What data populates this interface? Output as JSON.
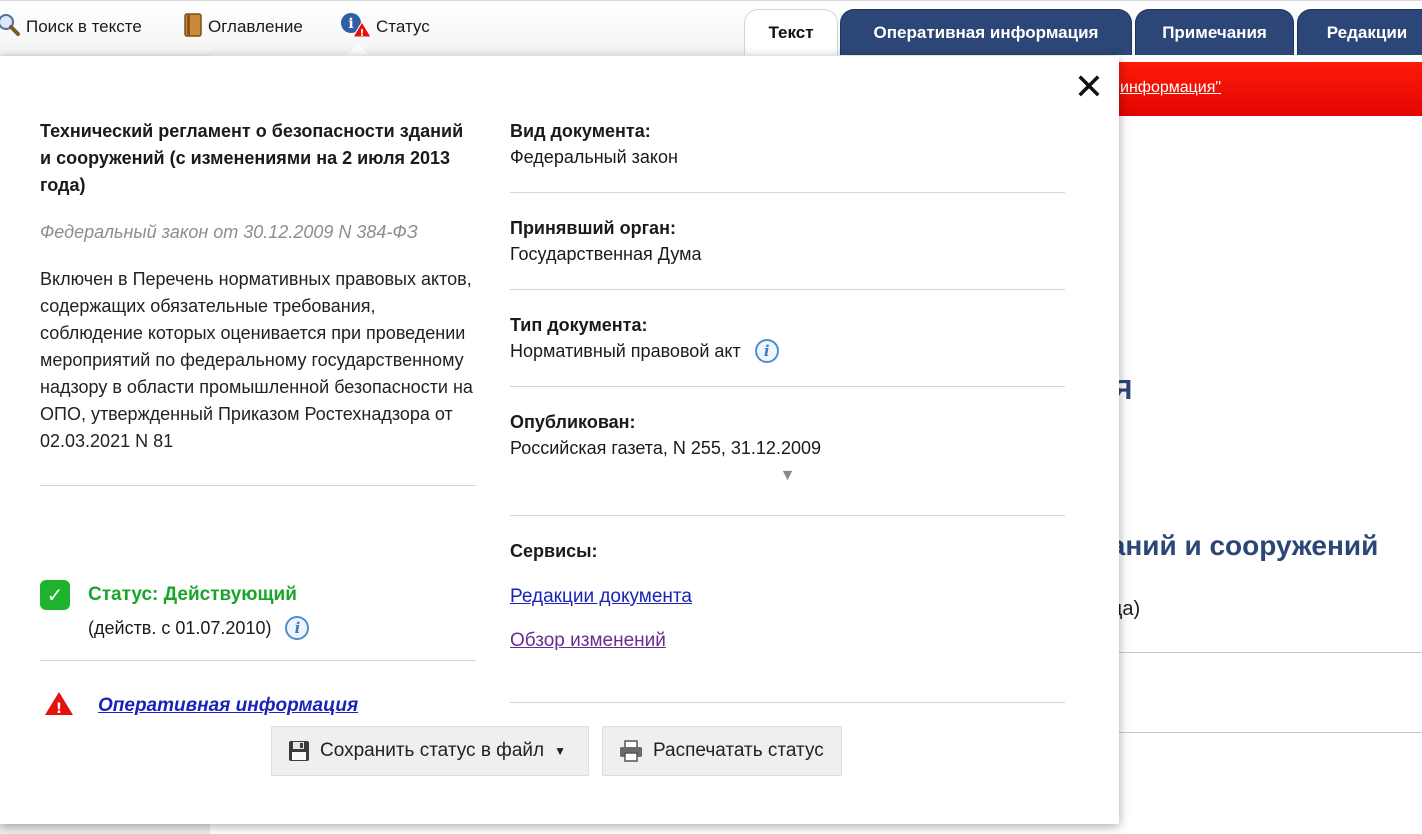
{
  "toolbar": {
    "search_label": "Поиск в тексте",
    "toc_label": "Оглавление",
    "status_label": "Статус"
  },
  "tabs": [
    {
      "label": "Текст",
      "active": true
    },
    {
      "label": "Оперативная информация",
      "active": false
    },
    {
      "label": "Примечания",
      "active": false
    },
    {
      "label": "Редакции",
      "active": false
    }
  ],
  "background_doc": {
    "banner_link": "информация\"",
    "heading_fragment_1": "ИЯ",
    "heading_fragment_2": "Я",
    "heading_fragment_3": "даний и сооружений",
    "text_fragment": "ода)"
  },
  "popup": {
    "close_symbol": "✕",
    "title": "Технический регламент о безопасности зданий и сооружений (с изменениями на 2 июля 2013 года)",
    "subtitle": "Федеральный закон от 30.12.2009 N 384-ФЗ",
    "description": "Включен в Перечень нормативных правовых актов, содержащих обязательные требования, соблюдение которых оценивается при проведении мероприятий по федеральному государственному надзору в области промышленной безопасности на ОПО, утвержденный Приказом Ростехнадзора от 02.03.2021 N 81",
    "status": {
      "label": "Статус: Действующий",
      "since": "(действ. с 01.07.2010)"
    },
    "operative_link": "Оперативная информация",
    "fields": {
      "doc_kind_label": "Вид документа:",
      "doc_kind_value": "Федеральный закон",
      "authority_label": "Принявший орган:",
      "authority_value": "Государственная Дума",
      "doc_type_label": "Тип документа:",
      "doc_type_value": "Нормативный правовой акт",
      "published_label": "Опубликован:",
      "published_value": "Российская газета, N 255, 31.12.2009",
      "more_symbol": "▼"
    },
    "services": {
      "title": "Сервисы:",
      "editions_link": "Редакции документа",
      "changes_link": "Обзор изменений"
    },
    "buttons": {
      "save": "Сохранить статус в файл",
      "print": "Распечатать статус"
    }
  },
  "colors": {
    "tab_blue": "#2b4677",
    "status_green": "#1aa52a",
    "link_blue": "#1a23b8",
    "banner_red": "#e10600"
  }
}
